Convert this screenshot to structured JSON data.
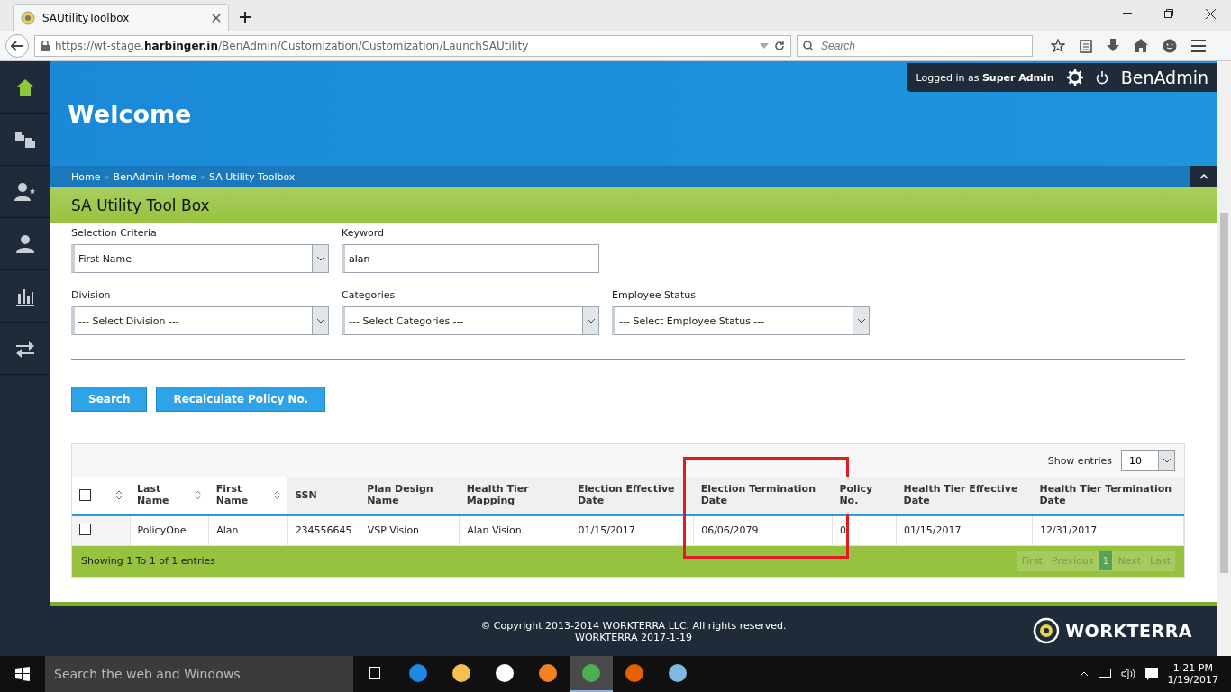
{
  "browser": {
    "tab_title": "SAUtilityToolbox",
    "url": "https://wt-stage.**harbinger.in**/BenAdmin/Customization/Customization/LaunchSAUtility",
    "search": {
      "placeholder": "Search"
    }
  },
  "sidebar": {
    "items": [
      {
        "selected": true
      },
      {
        "selected": false
      },
      {
        "selected": false
      },
      {
        "selected": false
      },
      {
        "selected": false
      },
      {
        "selected": false
      }
    ]
  },
  "header": {
    "title": "Welcome",
    "login_prefix": "Logged in as",
    "login_user": "Super Admin",
    "app_name": "BenAdmin"
  },
  "breadcrumbs": [
    "Home",
    "BenAdmin Home",
    "SA Utility Toolbox"
  ],
  "breadcrumb_separator": "»",
  "page_title": "SA Utility Tool Box",
  "form": {
    "selection_criteria": {
      "label": "Selection Criteria",
      "value": "First Name"
    },
    "keyword": {
      "label": "Keyword",
      "value": "alan"
    },
    "selects": [
      {
        "label": "Division",
        "value": "--- Select Division ---"
      },
      {
        "label": "Categories",
        "value": "--- Select Categories ---"
      },
      {
        "label": "Employee Status",
        "value": "--- Select Employee Status ---"
      }
    ],
    "buttons": [
      "Search",
      "Recalculate Policy No."
    ]
  },
  "table": {
    "show_entries_label": "Show entries",
    "page_size": "10",
    "select_all": {
      "checked": false
    },
    "columns": [
      {
        "label": "Last Name",
        "sortable": true,
        "highlighted": false
      },
      {
        "label": "First Name",
        "sortable": true,
        "highlighted": false
      },
      {
        "label": "SSN",
        "sortable": false,
        "highlighted": false
      },
      {
        "label": "Plan Design Name",
        "sortable": false,
        "highlighted": false
      },
      {
        "label": "Health Tier Mapping",
        "sortable": false,
        "highlighted": false
      },
      {
        "label": "Election Effective Date",
        "sortable": false,
        "highlighted": false
      },
      {
        "label": "Election Termination Date",
        "sortable": false,
        "highlighted": true
      },
      {
        "label": "Policy No.",
        "sortable": false,
        "highlighted": false
      },
      {
        "label": "Health Tier Effective Date",
        "sortable": false,
        "highlighted": false
      },
      {
        "label": "Health Tier Termination Date",
        "sortable": false,
        "highlighted": false
      }
    ],
    "rows": [
      {
        "checked": false,
        "cells": [
          "PolicyOne",
          "Alan",
          "234556645",
          "VSP Vision",
          "Alan Vision",
          "01/15/2017",
          "06/06/2079",
          "0",
          "01/15/2017",
          "12/31/2017"
        ]
      }
    ],
    "info": "Showing 1 To 1 of 1 entries",
    "pager": [
      {
        "label": "First",
        "selected": false
      },
      {
        "label": "Previous",
        "selected": false
      },
      {
        "label": "1",
        "selected": true
      },
      {
        "label": "Next",
        "selected": false
      },
      {
        "label": "Last",
        "selected": false
      }
    ]
  },
  "footer": {
    "copyright": "© Copyright 2013-2014 WORKTERRA LLC. All rights reserved.",
    "version": "WORKTERRA 2017-1-19",
    "logo_text": "WORKTERRA"
  },
  "taskbar": {
    "search_placeholder": "Search the web and Windows",
    "apps": [
      {
        "selected": false
      },
      {
        "selected": false
      },
      {
        "selected": false
      },
      {
        "selected": false
      },
      {
        "selected": false
      },
      {
        "selected": true
      },
      {
        "selected": false
      },
      {
        "selected": false
      }
    ],
    "time": "1:21 PM",
    "date": "1/19/2017"
  }
}
